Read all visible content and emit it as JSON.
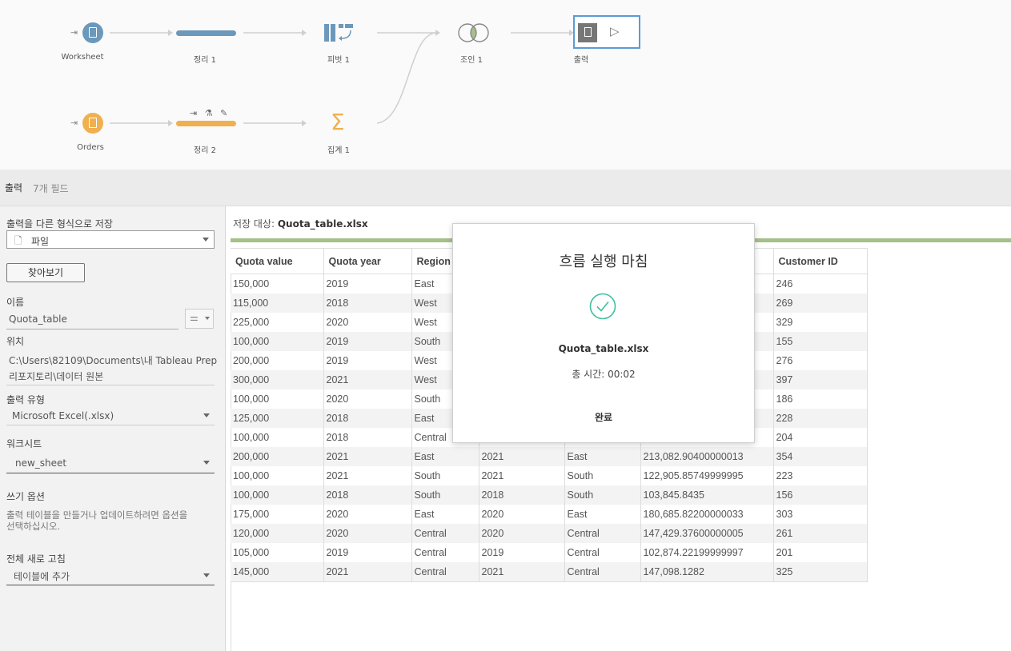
{
  "flow": {
    "worksheet_label": "Worksheet",
    "clean1_label": "정리 1",
    "pivot_label": "피벗 1",
    "join_label": "조인 1",
    "output_label": "출력",
    "orders_label": "Orders",
    "clean2_label": "정리 2",
    "aggregate_label": "집계 1",
    "colors": {
      "blue": "#6b98bb",
      "orange": "#f0b04f",
      "join_green": "#a6c08a"
    }
  },
  "step_header": {
    "title": "출력",
    "field_count": "7개 필드"
  },
  "settings": {
    "save_as_label": "출력을 다른 형식으로 저장",
    "save_as_value": "파일",
    "browse_button": "찾아보기",
    "name_label": "이름",
    "name_value": "Quota_table",
    "location_label": "위치",
    "location_line1": "C:\\Users\\82109\\Documents\\내 Tableau Prep",
    "location_line2": "리포지토리\\데이터 원본",
    "output_type_label": "출력 유형",
    "output_type_value": "Microsoft Excel(.xlsx)",
    "worksheet_label": "워크시트",
    "worksheet_value": "new_sheet",
    "write_option_label": "쓰기 옵션",
    "write_option_desc_line1": "출력 테이블을 만들거나 업데이트하려면 옵션을",
    "write_option_desc_line2": "선택하십시오.",
    "refresh_label": "전체 새로 고침",
    "refresh_value": "테이블에 추가"
  },
  "main": {
    "save_target_prefix": "저장 대상:",
    "save_target_file": "Quota_table.xlsx"
  },
  "table": {
    "columns": [
      "Quota value",
      "Quota year",
      "Region",
      "",
      "",
      "",
      "Customer ID"
    ],
    "rows": [
      [
        "150,000",
        "2019",
        "East",
        "",
        "",
        "",
        "246"
      ],
      [
        "115,000",
        "2018",
        "West",
        "",
        "",
        "",
        "269"
      ],
      [
        "225,000",
        "2020",
        "West",
        "",
        "",
        "",
        "329"
      ],
      [
        "100,000",
        "2019",
        "South",
        "",
        "",
        "",
        "155"
      ],
      [
        "200,000",
        "2019",
        "West",
        "",
        "",
        "",
        "276"
      ],
      [
        "300,000",
        "2021",
        "West",
        "",
        "",
        "",
        "397"
      ],
      [
        "100,000",
        "2020",
        "South",
        "",
        "",
        "",
        "186"
      ],
      [
        "125,000",
        "2018",
        "East",
        "",
        "",
        "",
        "228"
      ],
      [
        "100,000",
        "2018",
        "Central",
        "",
        "",
        "",
        "204"
      ],
      [
        "200,000",
        "2021",
        "East",
        "2021",
        "East",
        "213,082.90400000013",
        "354"
      ],
      [
        "100,000",
        "2021",
        "South",
        "2021",
        "South",
        "122,905.85749999995",
        "223"
      ],
      [
        "100,000",
        "2018",
        "South",
        "2018",
        "South",
        "103,845.8435",
        "156"
      ],
      [
        "175,000",
        "2020",
        "East",
        "2020",
        "East",
        "180,685.82200000033",
        "303"
      ],
      [
        "120,000",
        "2020",
        "Central",
        "2020",
        "Central",
        "147,429.37600000005",
        "261"
      ],
      [
        "105,000",
        "2019",
        "Central",
        "2019",
        "Central",
        "102,874.22199999997",
        "201"
      ],
      [
        "145,000",
        "2021",
        "Central",
        "2021",
        "Central",
        "147,098.1282",
        "325"
      ]
    ]
  },
  "modal": {
    "title": "흐름 실행 마침",
    "file": "Quota_table.xlsx",
    "time": "총 시간: 00:02",
    "done_button": "완료",
    "check_color": "#3fbf9e"
  }
}
